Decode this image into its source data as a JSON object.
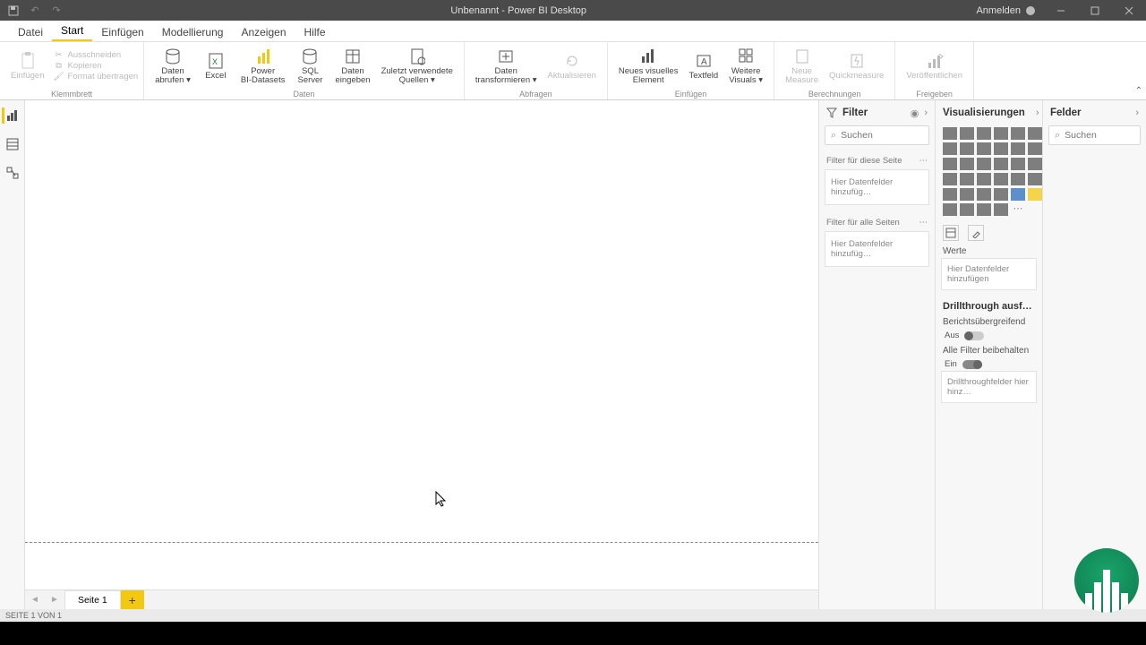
{
  "titlebar": {
    "title": "Unbenannt - Power BI Desktop",
    "signin": "Anmelden"
  },
  "menu": {
    "tabs": [
      "Datei",
      "Start",
      "Einfügen",
      "Modellierung",
      "Anzeigen",
      "Hilfe"
    ],
    "active_index": 1
  },
  "ribbon": {
    "clipboard": {
      "paste": "Einfügen",
      "cut": "Ausschneiden",
      "copy": "Kopieren",
      "format_painter": "Format übertragen",
      "group": "Klemmbrett"
    },
    "data": {
      "get_data": "Daten\nabrufen ▾",
      "excel": "Excel",
      "pbi_datasets": "Power\nBI-Datasets",
      "sql_server": "SQL\nServer",
      "enter_data": "Daten\neingeben",
      "recent_sources": "Zuletzt verwendete\nQuellen ▾",
      "group": "Daten"
    },
    "queries": {
      "transform": "Daten\ntransformieren ▾",
      "refresh": "Aktualisieren",
      "group": "Abfragen"
    },
    "insert": {
      "new_visual": "Neues visuelles\nElement",
      "textbox": "Textfeld",
      "more_visuals": "Weitere\nVisuals ▾",
      "group": "Einfügen"
    },
    "calc": {
      "new_measure": "Neue\nMeasure",
      "quick_measure": "Quickmeasure",
      "group": "Berechnungen"
    },
    "share": {
      "publish": "Veröffentlichen",
      "group": "Freigeben"
    }
  },
  "filter_pane": {
    "title": "Filter",
    "search_placeholder": "Suchen",
    "page_filters_label": "Filter für diese Seite",
    "all_pages_label": "Filter für alle Seiten",
    "drop_hint": "Hier Datenfelder hinzufüg…"
  },
  "viz_pane": {
    "title": "Visualisierungen",
    "values_label": "Werte",
    "values_hint": "Hier Datenfelder hinzufügen",
    "drill_title": "Drillthrough ausfü…",
    "cross_report_label": "Berichtsübergreifend",
    "cross_report_state": "Aus",
    "keep_filters_label": "Alle Filter beibehalten",
    "keep_filters_state": "Ein",
    "drill_hint": "Drillthroughfelder hier hinz…"
  },
  "fields_pane": {
    "title": "Felder",
    "search_placeholder": "Suchen"
  },
  "pages": {
    "tab1": "Seite 1"
  },
  "statusbar": {
    "text": "SEITE 1 VON 1"
  }
}
